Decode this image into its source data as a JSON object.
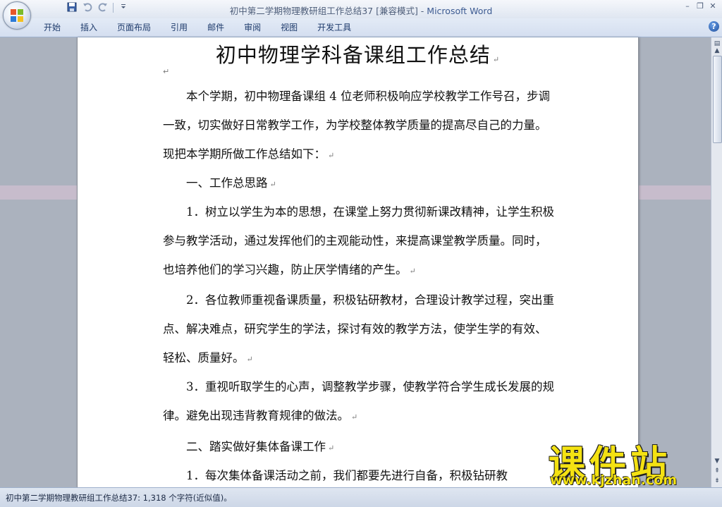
{
  "window": {
    "title": "初中第二学期物理教研组工作总结37 [兼容模式] - ",
    "app_name": "Microsoft Word",
    "controls": [
      "–",
      "❐",
      "✕"
    ]
  },
  "quick_access": {
    "save_icon": "save-icon",
    "undo_icon": "undo-icon",
    "redo_icon": "redo-icon",
    "customize_icon": "dropdown-icon"
  },
  "ribbon": {
    "tabs": [
      "开始",
      "插入",
      "页面布局",
      "引用",
      "邮件",
      "审阅",
      "视图",
      "开发工具"
    ],
    "help": "?"
  },
  "document": {
    "title": "初中物理学科备课组工作总结",
    "paragraph_mark": "↵",
    "paragraphs": [
      "　　本个学期，初中物理备课组 4 位老师积极响应学校教学工作号召，步调一致，切实做好日常教学工作，为学校整体教学质量的提高尽自己的力量。现把本学期所做工作总结如下：",
      "　　一、工作总思路",
      "　　1．树立以学生为本的思想，在课堂上努力贯彻新课改精神，让学生积极参与教学活动，通过发挥他们的主观能动性，来提高课堂教学质量。同时，也培养他们的学习兴趣，防止厌学情绪的产生。",
      "　　2．各位教师重视备课质量，积极钻研教材，合理设计教学过程，突出重点、解决难点，研究学生的学法，探讨有效的教学方法，使学生学的有效、轻松、质量好。",
      "　　3．重视听取学生的心声，调整教学步骤，使教学符合学生成长发展的规律。避免出现违背教育规律的做法。",
      "　　二、踏实做好集体备课工作",
      "　　1．每次集体备课活动之前，我们都要先进行自备，积极钻研教"
    ]
  },
  "status_bar": {
    "text": "初中第二学期物理教研组工作总结37: 1,318 个字符(近似值)。"
  },
  "watermark": {
    "brand": "课件站",
    "url": "www.kjzhan.com"
  },
  "colors": {
    "accent": "#1d3a6b",
    "watermark": "#f4e212"
  }
}
